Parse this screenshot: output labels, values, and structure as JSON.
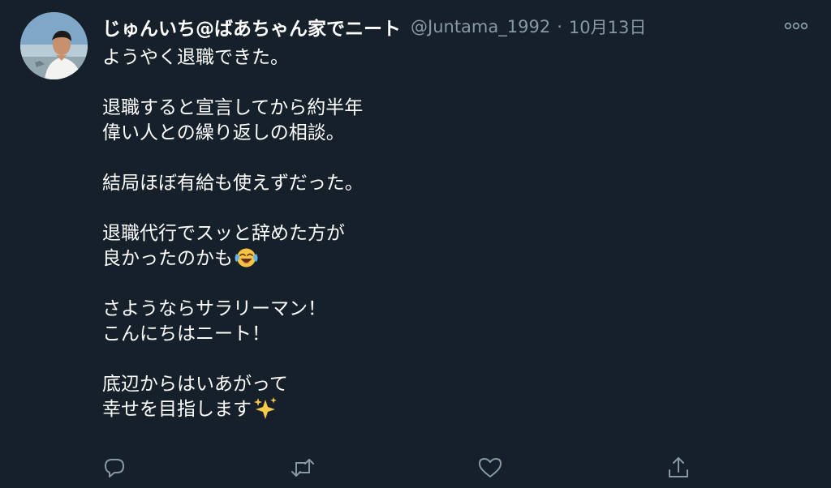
{
  "tweet": {
    "display_name": "じゅんいち@ばあちゃん家でニート",
    "handle": "@Juntama_1992",
    "separator": "·",
    "date": "10月13日",
    "more_icon": "more-horizontal-icon",
    "avatar": "avatar-photo",
    "lines": [
      "ようやく退職できた。",
      "",
      "退職すると宣言してから約半年",
      "偉い人との繰り返しの相談。",
      "",
      "結局ほぼ有給も使えずだった。",
      "",
      "退職代行でスッと辞めた方が",
      "良かったのかも",
      "",
      "さようならサラリーマン！",
      "こんにちはニート！",
      "",
      "底辺からはいあがって",
      "幸せを目指します"
    ],
    "emojis": {
      "line_8": "face-with-tears-of-joy-emoji",
      "line_14": "sparkles-emoji"
    }
  },
  "actions": [
    {
      "name": "reply",
      "icon": "reply-icon"
    },
    {
      "name": "retweet",
      "icon": "retweet-icon"
    },
    {
      "name": "like",
      "icon": "heart-icon"
    },
    {
      "name": "share",
      "icon": "share-icon"
    }
  ],
  "colors": {
    "background": "#15202b",
    "text": "#ffffff",
    "secondary": "#8899a6"
  }
}
